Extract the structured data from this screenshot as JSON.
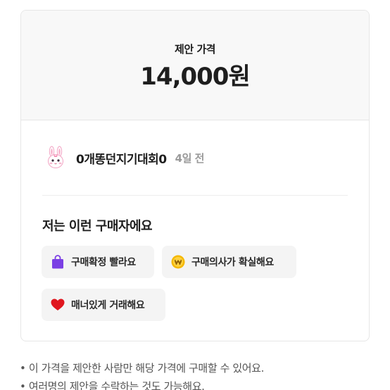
{
  "offer": {
    "label": "제안 가격",
    "amount": "14,000원"
  },
  "seller": {
    "avatar_icon": "bunny-avatar-icon",
    "name": "0개똥던지기대회0",
    "time": "4일 전"
  },
  "buyer_section": {
    "title": "저는 이런 구매자에요",
    "badges": [
      {
        "label": "구매확정 빨라요",
        "icon": "shopping-bag-icon",
        "color": "#7b3fe4"
      },
      {
        "label": "구매의사가 확실해요",
        "icon": "won-coin-icon",
        "color": "#f5b800"
      },
      {
        "label": "매너있게 거래해요",
        "icon": "heart-icon",
        "color": "#e0161e"
      }
    ]
  },
  "notes": [
    "• 이 가격을 제안한 사람만 해당 가격에 구매할 수 있어요.",
    "• 여러명의 제안을 수락하는 것도 가능해요."
  ]
}
